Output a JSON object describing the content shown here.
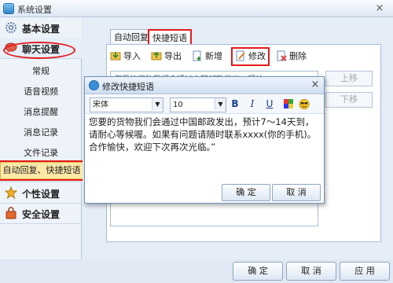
{
  "window": {
    "title": "系统设置",
    "close_glyph": "×"
  },
  "sidebar": {
    "sections": [
      {
        "label": "基本设置",
        "icon": "gear-icon"
      },
      {
        "label": "聊天设置",
        "icon": "chat-icon"
      },
      {
        "label": "个性设置",
        "icon": "star-icon"
      },
      {
        "label": "安全设置",
        "icon": "lock-icon"
      }
    ],
    "chat_items": [
      "常规",
      "语音视频",
      "消息提醒",
      "消息记录",
      "文件记录",
      "自动回复、快捷短语"
    ]
  },
  "tabs": [
    "自动回复",
    "快捷短语"
  ],
  "toolbar": {
    "import": "导入",
    "export": "导出",
    "add": "新增",
    "edit": "修改",
    "delete": "删除"
  },
  "list": {
    "first_item": "您要的货物我们会通过中国邮政发出，预计7～14",
    "move_up": "上移",
    "move_down": "下移"
  },
  "dialog": {
    "title": "修改快捷短语",
    "close_glyph": "×",
    "font": "宋体",
    "size": "10",
    "bold": "B",
    "italic": "I",
    "underline": "U",
    "body": "您要的货物我们会通过中国邮政发出，预计7～14天到，请耐心等候喔。如果有问题请随时联系xxxx(你的手机)。合作愉快，欢迎下次再次光临。”",
    "ok": "确 定",
    "cancel": "取 消"
  },
  "footer": {
    "ok": "确 定",
    "cancel": "取 消",
    "apply": "应 用"
  },
  "colors": {
    "highlight_red": "#e31b1b",
    "selected_bg": "#ffe9a8"
  }
}
